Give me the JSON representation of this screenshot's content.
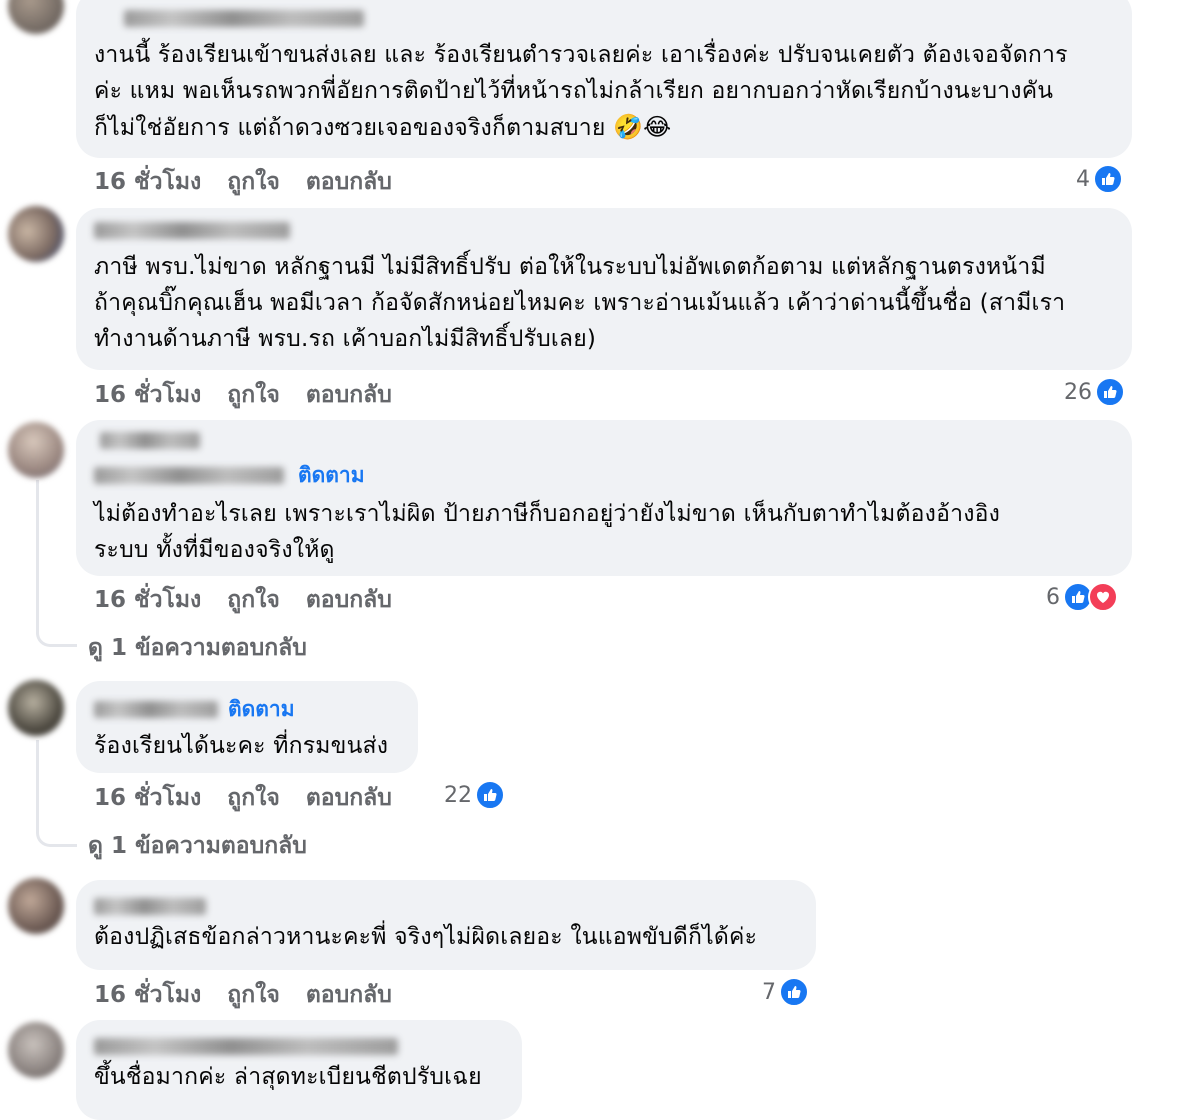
{
  "comments": [
    {
      "lines": [
        "งานนี้ ร้องเรียนเข้าขนส่งเลย และ ร้องเรียนตำรวจเลยค่ะ เอาเรื่องค่ะ ปรับจนเคยตัว ต้องเจอจัดการ",
        "ค่ะ แหม พอเห็นรถพวกพี่อัยการติดป้ายไว้ที่หน้ารถไม่กล้าเรียก อยากบอกว่าหัดเรียกบ้างนะบางคัน",
        "ก็ไม่ใช่อัยการ แต่ถ้าดวงซวยเจอของจริงก็ตามสบาย"
      ],
      "emojis": [
        "🤣",
        "😂"
      ],
      "time": "16 ชั่วโมง",
      "like": "ถูกใจ",
      "reply": "ตอบกลับ",
      "reaction_count": "4"
    },
    {
      "lines": [
        "ภาษี พรบ.ไม่ขาด หลักฐานมี ไม่มีสิทธิ์ปรับ ต่อให้ในระบบไม่อัพเดตก้อตาม แต่หลักฐานตรงหน้ามี",
        "ถ้าคุณบิ๊กคุณเฮ็น พอมีเวลา ก้อจัดสักหน่อยไหมคะ เพราะอ่านเม้นแล้ว เค้าว่าด่านนี้ขึ้นชื่อ (สามีเรา",
        "ทำงานด้านภาษี พรบ.รถ เค้าบอกไม่มีสิทธิ์ปรับเลย)"
      ],
      "time": "16 ชั่วโมง",
      "like": "ถูกใจ",
      "reply": "ตอบกลับ",
      "reaction_count": "26"
    },
    {
      "follow": "ติดตาม",
      "lines": [
        "ไม่ต้องทำอะไรเลย เพราะเราไม่ผิด ป้ายภาษีก็บอกอยู่ว่ายังไม่ขาด เห็นกับตาทำไมต้องอ้างอิง",
        "ระบบ ทั้งที่มีของจริงให้ดู"
      ],
      "time": "16 ชั่วโมง",
      "like": "ถูกใจ",
      "reply": "ตอบกลับ",
      "reaction_count": "6",
      "view_replies": "ดู 1 ข้อความตอบกลับ"
    },
    {
      "follow": "ติดตาม",
      "lines": [
        "ร้องเรียนได้นะคะ ที่กรมขนส่ง"
      ],
      "time": "16 ชั่วโมง",
      "like": "ถูกใจ",
      "reply": "ตอบกลับ",
      "reaction_count": "22",
      "view_replies": "ดู 1 ข้อความตอบกลับ"
    },
    {
      "lines": [
        "ต้องปฏิเสธข้อกล่าวหานะคะพี่ จริงๆไม่ผิดเลยอะ ในแอพขับดีก็ได้ค่ะ"
      ],
      "time": "16 ชั่วโมง",
      "like": "ถูกใจ",
      "reply": "ตอบกลับ",
      "reaction_count": "7"
    },
    {
      "lines": [
        "ขึ้นชื่อมากค่ะ ล่าสุดทะเบียนชีตปรับเฉย"
      ]
    }
  ],
  "colors": {
    "bubble": "#f0f2f5",
    "link": "#1877f2",
    "meta": "#65676b",
    "like": "#1877f2",
    "love": "#f33e58"
  }
}
